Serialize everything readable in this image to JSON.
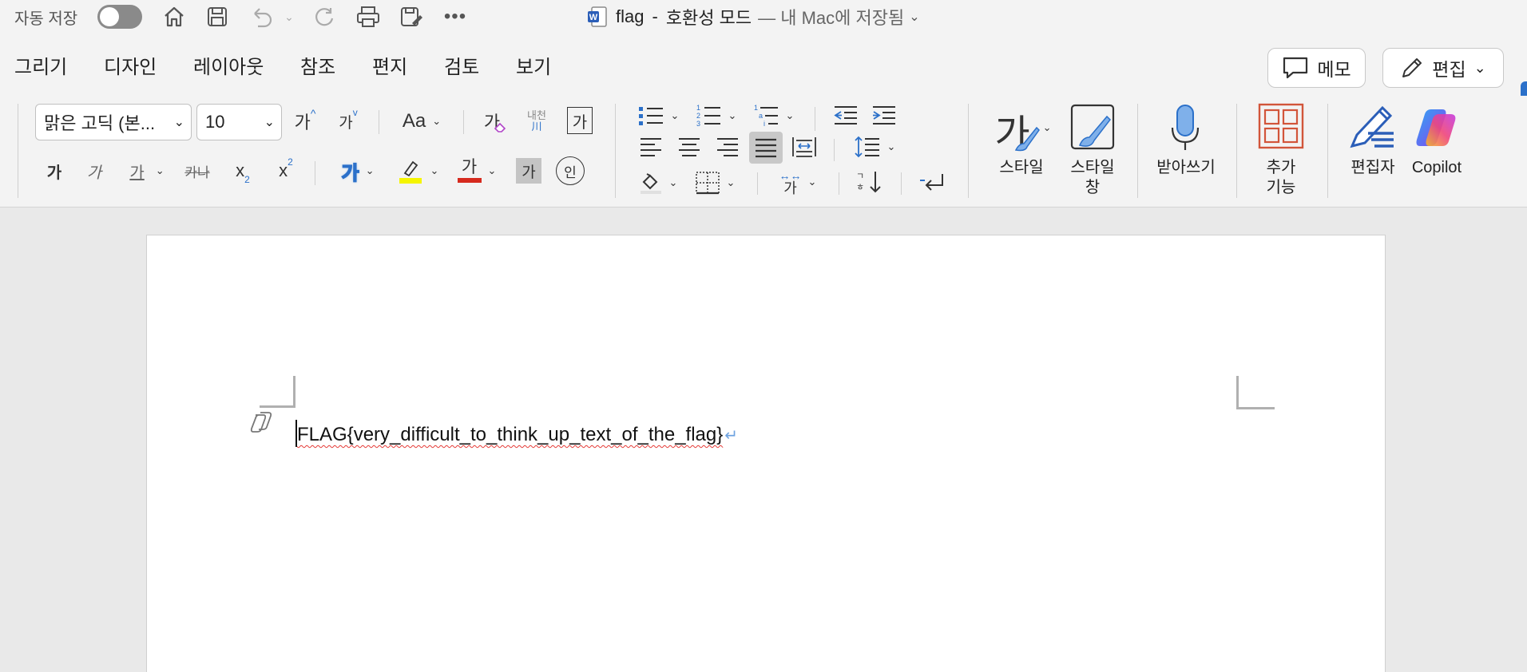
{
  "titlebar": {
    "autosave_label": "자동 저장",
    "doc_name": "flag",
    "doc_mode": "호환성 모드",
    "doc_location": "— 내 Mac에 저장됨"
  },
  "tabs": [
    "그리기",
    "디자인",
    "레이아웃",
    "참조",
    "편지",
    "검토",
    "보기"
  ],
  "top_buttons": {
    "memo": "메모",
    "edit": "편집"
  },
  "ribbon": {
    "font_name": "맑은 고딕 (본...",
    "font_size": "10",
    "grow_font": "가",
    "shrink_font": "가",
    "change_case": "Aa",
    "clear_format": "가",
    "phonetic_top": "내천",
    "phonetic_bottom": "川",
    "char_border": "가",
    "bold": "가",
    "italic": "가",
    "underline": "가",
    "strike": "카나",
    "subscript": "x",
    "subscript_mark": "2",
    "superscript": "x",
    "superscript_mark": "2",
    "text_effects": "가",
    "font_color": "가",
    "char_shading": "가",
    "enclose": "인",
    "styles_glyph": "가",
    "styles_label": "스타일",
    "styles_pane_line1": "스타일",
    "styles_pane_line2": "창",
    "dictate_label": "받아쓰기",
    "addins_line1": "추가",
    "addins_line2": "기능",
    "editor_label": "편집자",
    "copilot_label": "Copilot",
    "asian_layout": "가",
    "text_direction": "가"
  },
  "document": {
    "text": "FLAG{very_difficult_to_think_up_text_of_the_flag}",
    "para_mark": "↵"
  },
  "colors": {
    "accent_blue": "#2b70c9",
    "highlight_yellow": "#f5f500",
    "font_color_red": "#d62a1e",
    "addins_orange": "#d2553a",
    "spell_red": "#e53935"
  }
}
